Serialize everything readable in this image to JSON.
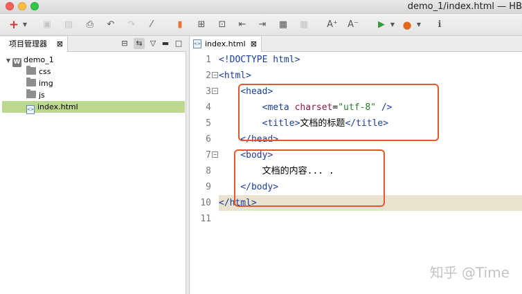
{
  "window": {
    "title": "demo_1/index.html — HB"
  },
  "toolbar": {
    "buttons": [
      "new",
      "save",
      "save-all",
      "publish",
      "undo",
      "redo",
      "format",
      "bookmark",
      "new-file",
      "new-folder",
      "go-back",
      "go-forward",
      "preview",
      "preview-alt",
      "font-increase",
      "font-decrease",
      "run",
      "firefox",
      "info"
    ]
  },
  "left_panel": {
    "tab_label": "项目管理器",
    "tab_close": "⊠",
    "tree": [
      {
        "label": "demo_1",
        "type": "project",
        "expanded": true
      },
      {
        "label": "css",
        "type": "folder"
      },
      {
        "label": "img",
        "type": "folder"
      },
      {
        "label": "js",
        "type": "folder"
      },
      {
        "label": "index.html",
        "type": "file",
        "selected": true
      }
    ]
  },
  "editor": {
    "tab_label": "index.html",
    "tab_close": "⊠",
    "line_numbers": [
      "1",
      "2",
      "3",
      "4",
      "5",
      "6",
      "7",
      "8",
      "9",
      "10",
      "11"
    ],
    "current_line": 10,
    "code": {
      "l1": "<!DOCTYPE html>",
      "l2": "<html>",
      "l3": "<head>",
      "l4_tag_open": "<meta ",
      "l4_attr": "charset",
      "l4_eq": "=",
      "l4_str": "\"utf-8\"",
      "l4_end": " />",
      "l5_open": "<title>",
      "l5_text": "文档的标题",
      "l5_close": "</title>",
      "l6": "</head>",
      "l7": "<body>",
      "l8_text": "文档的内容... .",
      "l9": "</body>",
      "l10": "</html>",
      "l11": ""
    }
  },
  "watermark": "知乎 @Time",
  "colors": {
    "highlight_box": "#e4572e",
    "selection": "#bcd88f",
    "current_line": "#e9e2cf",
    "tag": "#1a3d9a",
    "attr": "#8b1a4b",
    "string": "#2a7d2a"
  }
}
